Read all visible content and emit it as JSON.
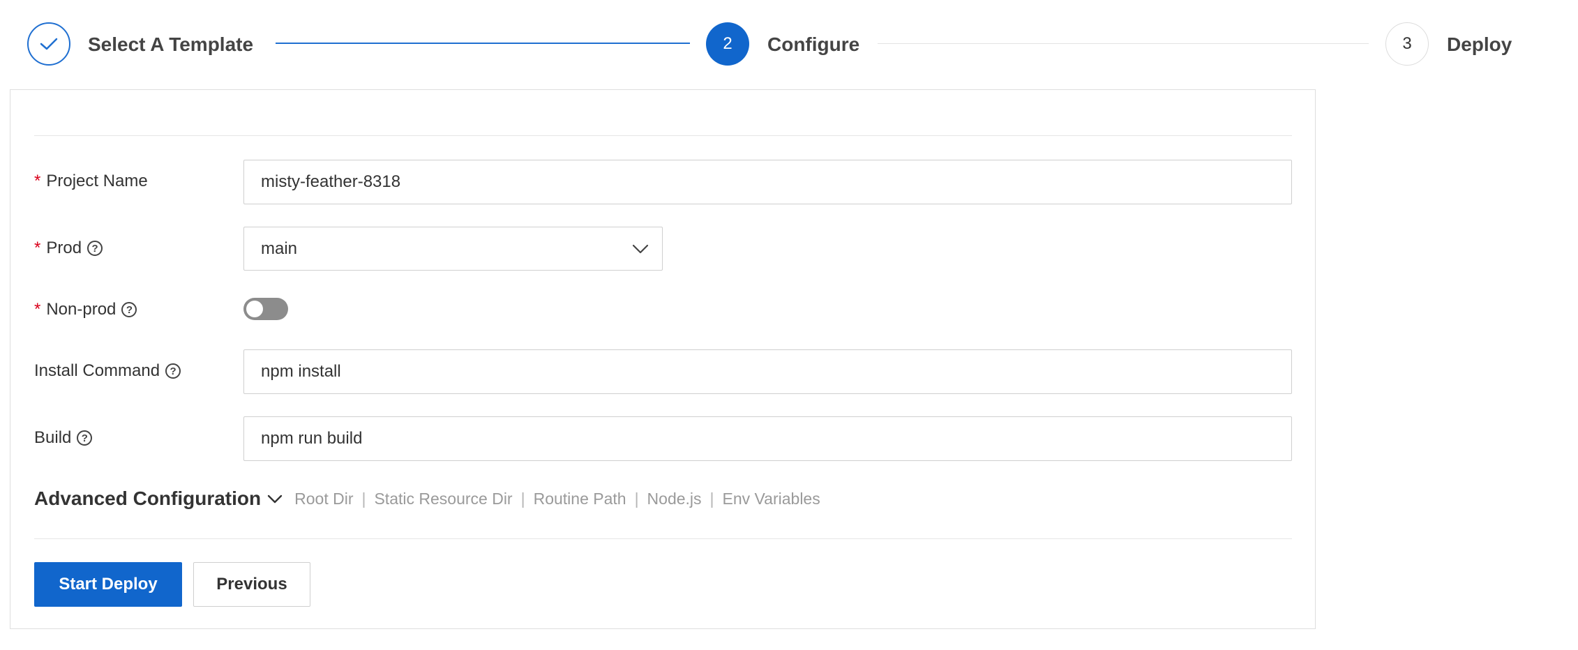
{
  "steps": [
    {
      "number": "",
      "label": "Select A Template",
      "status": "completed",
      "icon": "check-icon"
    },
    {
      "number": "2",
      "label": "Configure",
      "status": "active"
    },
    {
      "number": "3",
      "label": "Deploy",
      "status": "pending"
    }
  ],
  "form": {
    "required_mark": "*",
    "project_name": {
      "label": "Project Name",
      "value": "misty-feather-8318"
    },
    "prod": {
      "label": "Prod",
      "value": "main",
      "help_icon": "?"
    },
    "non_prod": {
      "label": "Non-prod",
      "enabled": false,
      "help_icon": "?"
    },
    "install_command": {
      "label": "Install Command",
      "value": "npm install",
      "help_icon": "?"
    },
    "build": {
      "label": "Build",
      "value": "npm run build",
      "help_icon": "?"
    }
  },
  "advanced": {
    "title": "Advanced Configuration",
    "separator": "|",
    "items": [
      "Root Dir",
      "Static Resource Dir",
      "Routine Path",
      "Node.js",
      "Env Variables"
    ]
  },
  "actions": {
    "start_deploy": "Start Deploy",
    "previous": "Previous"
  },
  "colors": {
    "primary": "#1166cc",
    "required": "#d9001b",
    "muted": "#9a9a9a",
    "toggle_off": "#8c8c8c"
  }
}
